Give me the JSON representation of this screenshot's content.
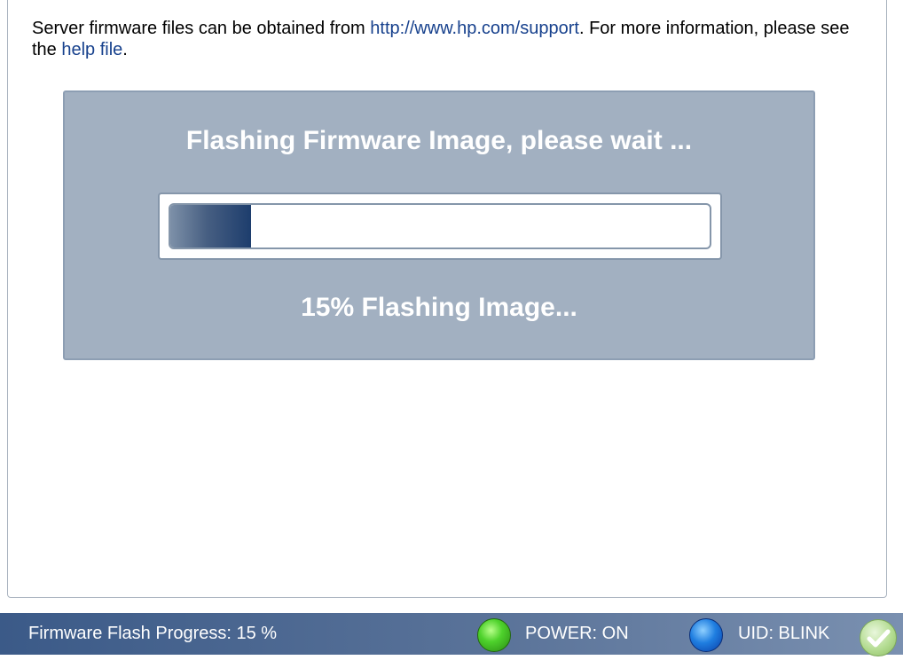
{
  "intro": {
    "text_before": "Server firmware files can be obtained from ",
    "support_link": "http://www.hp.com/support",
    "text_middle": ". For more information, please see the ",
    "help_link": "help file",
    "text_after": "."
  },
  "flash": {
    "title": "Flashing Firmware Image, please wait ...",
    "progress_fraction": 0.15,
    "status": "15% Flashing Image..."
  },
  "status_bar": {
    "progress_label": "Firmware Flash Progress: 15 %",
    "power_label": "POWER: ON",
    "uid_label": "UID: BLINK",
    "power_led_color": "#4ed22c",
    "uid_led_color": "#1f7ee0",
    "check_icon": "checkmark-icon"
  },
  "colors": {
    "panel_bg": "#a2b0c1",
    "link": "#17418d",
    "progress_fill": "#1d3d6d",
    "status_bar": "#3b5a88"
  }
}
